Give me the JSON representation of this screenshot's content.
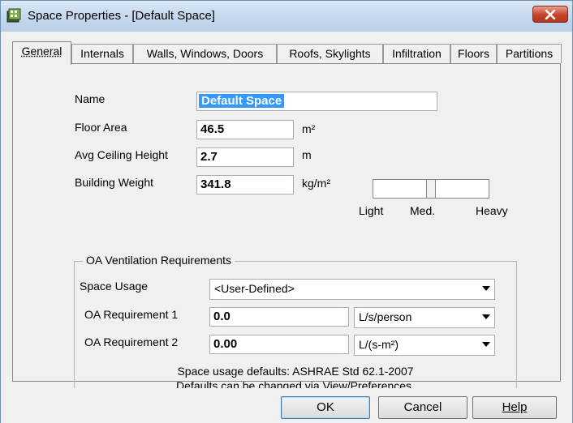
{
  "window": {
    "title": "Space Properties - [Default Space]"
  },
  "tabs": [
    {
      "label": "General"
    },
    {
      "label": "Internals"
    },
    {
      "label": "Walls, Windows, Doors"
    },
    {
      "label": "Roofs, Skylights"
    },
    {
      "label": "Infiltration"
    },
    {
      "label": "Floors"
    },
    {
      "label": "Partitions"
    }
  ],
  "general": {
    "name_label": "Name",
    "name_value": "Default Space",
    "floor_area_label": "Floor Area",
    "floor_area_value": "46.5",
    "floor_area_unit": "m²",
    "ceiling_label": "Avg Ceiling Height",
    "ceiling_value": "2.7",
    "ceiling_unit": "m",
    "weight_label": "Building Weight",
    "weight_value": "341.8",
    "weight_unit": "kg/m²",
    "slider": {
      "light": "Light",
      "med": "Med.",
      "heavy": "Heavy",
      "level": 0.5
    }
  },
  "oa": {
    "group_title": "OA Ventilation Requirements",
    "usage_label": "Space Usage",
    "usage_value": "<User-Defined>",
    "req1_label": "OA Requirement 1",
    "req1_value": "0.0",
    "req1_unit": "L/s/person",
    "req2_label": "OA Requirement 2",
    "req2_value": "0.00",
    "req2_unit": "L/(s-m²)",
    "note_line1": "Space usage defaults: ASHRAE Std 62.1-2007",
    "note_line2": "Defaults can be changed via View/Preferences."
  },
  "buttons": {
    "ok": "OK",
    "cancel": "Cancel",
    "help": "Help"
  },
  "colors": {
    "selection": "#3399ff",
    "close": "#c7432a"
  }
}
